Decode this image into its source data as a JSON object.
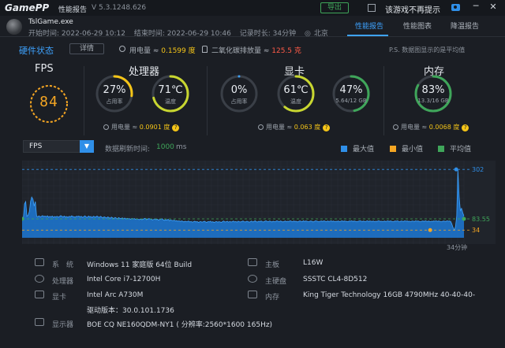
{
  "titlebar": {
    "logo_a": "Game",
    "logo_b": "PP",
    "app_label": "性能报告",
    "version": "V 5.3.1248.626",
    "export_label": "导出",
    "no_prompt_label": "该游戏不再提示",
    "minimize": "─",
    "close": "✕"
  },
  "header": {
    "game_name": "TslGame.exe",
    "start_time": "开始时间: 2022-06-29 10:12",
    "end_time": "结束时间: 2022-06-29 10:46",
    "duration": "记录时长: 34分钟",
    "location": "北京",
    "tabs": [
      {
        "label": "性能报告",
        "active": true
      },
      {
        "label": "性能图表",
        "active": false
      },
      {
        "label": "降温报告",
        "active": false
      }
    ]
  },
  "status": {
    "title": "硬件状态",
    "detail_label": "详情",
    "power_prefix": "用电量 ≈ ",
    "power_value": "0.1599 度",
    "co2_prefix": "二氧化碳排放量 ≈ ",
    "co2_value": "125.5 克",
    "note": "P.S. 数据图显示的是平均值"
  },
  "fps": {
    "label": "FPS",
    "value": "84"
  },
  "cpu": {
    "title": "处理器",
    "usage_value": "27%",
    "usage_label": "占用率",
    "usage_fraction": 0.27,
    "temp_value": "71℃",
    "temp_label": "温度",
    "temp_fraction": 0.71,
    "power_prefix": "用电量 ≈ ",
    "power_value": "0.0901 度"
  },
  "gpu": {
    "title": "显卡",
    "usage_value": "0%",
    "usage_label": "占用率",
    "usage_fraction": 0.0,
    "temp_value": "61℃",
    "temp_label": "温度",
    "temp_fraction": 0.61,
    "mem_value": "47%",
    "mem_label": "5.64/12 GB",
    "mem_fraction": 0.47,
    "power_prefix": "用电量 ≈ ",
    "power_value": "0.063 度"
  },
  "ram": {
    "title": "内存",
    "usage_value": "83%",
    "usage_label": "13.3/16 GB",
    "usage_fraction": 0.83,
    "power_prefix": "用电量 ≈ ",
    "power_value": "0.0068 度"
  },
  "colors": {
    "accent": "#3ea3ff",
    "green": "#3fa65a",
    "yellow": "#f5c518",
    "orange": "#f5a623",
    "red": "#ff5b48",
    "ring_track": "#3a3f47"
  },
  "chart_controls": {
    "metric": "FPS",
    "refresh_label": "数据刷新时间:",
    "refresh_value": "1000",
    "refresh_unit": "ms",
    "legend": [
      {
        "label": "最大值",
        "color": "#2f8fe8"
      },
      {
        "label": "最小值",
        "color": "#f5a623"
      },
      {
        "label": "平均值",
        "color": "#3fa65a"
      }
    ],
    "time_label": "34分钟"
  },
  "chart_data": {
    "type": "area",
    "title": "",
    "xlabel": "",
    "ylabel": "",
    "x_unit": "分钟",
    "x_range": [
      0,
      34
    ],
    "max": 302,
    "avg": 83.55,
    "min": 34,
    "markers": [
      {
        "label": "302",
        "value": 302,
        "x": 33.4
      },
      {
        "label": "83.55",
        "value": 83.55,
        "x": 34
      },
      {
        "label": "34",
        "value": 34,
        "x": 31.4
      }
    ],
    "series": [
      {
        "values": [
          84,
          82,
          150,
          160,
          95,
          100,
          115,
          160,
          180,
          170,
          140,
          160,
          95,
          93,
          97,
          92,
          95,
          98,
          94,
          96,
          93,
          97,
          91,
          95,
          92,
          96,
          90,
          94,
          92,
          95,
          91,
          94,
          98,
          95,
          92,
          96,
          91,
          94,
          90,
          95,
          92,
          97,
          94,
          93,
          91,
          95,
          94,
          96,
          92,
          95,
          90,
          93,
          97,
          92,
          90,
          96,
          92,
          94,
          89,
          95,
          93,
          91,
          96,
          92,
          90,
          95,
          91,
          88,
          93,
          90,
          87,
          92,
          89,
          86,
          91,
          88,
          85,
          90,
          87,
          84,
          89,
          86,
          85,
          88,
          84,
          87,
          83,
          86,
          85,
          84,
          82,
          86,
          83,
          85,
          81,
          84,
          82,
          80,
          83,
          80,
          81,
          84,
          86,
          80,
          82,
          85,
          83,
          82,
          79,
          81,
          84,
          80,
          82,
          78,
          81,
          83,
          84,
          79,
          77,
          80,
          78,
          82,
          75,
          79,
          77,
          76,
          78,
          74,
          76,
          73,
          75,
          72,
          74,
          73,
          70,
          73,
          71,
          72,
          74,
          70,
          72,
          69,
          71,
          73,
          70,
          72,
          68,
          70,
          72,
          69,
          71,
          73,
          70,
          68,
          72,
          70,
          73,
          69,
          71,
          68,
          70,
          72,
          69,
          71,
          70,
          68,
          72,
          74,
          70,
          71,
          73,
          69,
          72,
          70,
          71,
          74,
          70,
          72,
          69,
          73,
          71,
          70,
          72,
          74,
          71,
          70,
          73,
          72,
          69,
          71,
          74,
          70,
          72,
          75,
          71,
          70,
          73,
          72,
          74,
          71,
          70,
          73,
          75,
          72,
          71,
          74,
          72,
          70,
          73,
          71,
          72,
          75,
          73,
          71,
          74,
          72,
          70,
          72,
          74,
          71,
          73,
          72,
          75,
          73,
          71,
          74,
          72,
          73,
          70,
          72,
          74,
          73,
          71,
          75,
          72,
          74,
          73,
          71,
          72,
          74,
          73,
          70,
          72,
          75,
          74,
          72,
          71,
          73,
          74,
          72,
          75,
          73,
          71,
          74,
          72,
          73,
          75,
          72,
          74,
          71,
          73,
          72,
          74,
          71,
          73,
          75,
          72,
          74,
          73,
          72,
          71,
          74,
          73,
          75,
          72,
          74,
          73,
          71,
          72,
          74,
          75,
          73,
          72,
          74,
          71,
          73,
          75,
          72,
          74,
          73,
          72,
          74,
          71,
          73,
          72,
          75,
          74,
          72,
          73,
          71,
          74,
          72,
          73,
          75,
          72,
          74,
          73,
          71,
          72,
          74,
          73,
          75,
          72,
          71,
          74,
          73,
          72,
          75,
          73,
          74,
          72,
          73,
          71,
          74,
          73,
          72,
          75,
          73,
          74,
          72,
          71,
          73,
          74,
          72,
          75,
          73,
          72,
          74,
          71,
          73,
          72,
          74,
          73,
          75,
          72,
          74,
          73,
          71,
          72,
          74,
          73,
          72,
          75,
          73,
          74,
          72,
          60,
          45,
          34,
          50,
          95,
          302,
          180,
          120,
          130,
          110,
          96
        ]
      }
    ]
  },
  "system": {
    "os_key": "系　统",
    "os_val": "Windows 11 家庭版 64位   Build",
    "cpu_key": "处理器",
    "cpu_val": "Intel Core i7-12700H",
    "gpu_key": "显卡",
    "gpu_val": "Intel Arc A730M",
    "driver_val": "驱动版本：30.0.101.1736",
    "display_key": "显示器",
    "display_val": "BOE CQ NE160QDM-NY1 ( 分辨率:2560*1600 165Hz)",
    "board_key": "主板",
    "board_val": "L16W",
    "disk_key": "主硬盘",
    "disk_val": "SSSTC CL4-8D512",
    "mem_key": "内存",
    "mem_val": "King Tiger Technology 16GB 4790MHz 40-40-40-"
  }
}
